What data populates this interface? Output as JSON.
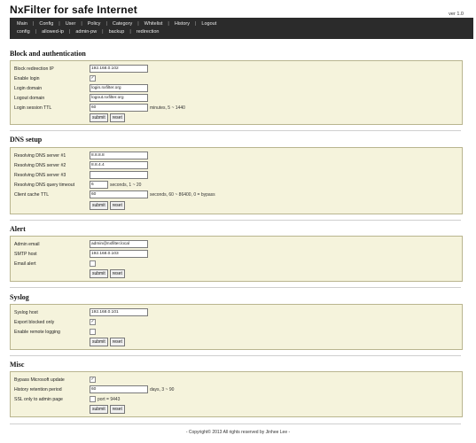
{
  "app": {
    "title": "NxFilter for safe Internet",
    "version": "ver 1.0"
  },
  "nav": {
    "row1": [
      "Main",
      "Config",
      "User",
      "Policy",
      "Category",
      "Whitelist",
      "History",
      "Logout"
    ],
    "row2": [
      "config",
      "allowed-ip",
      "admin-pw",
      "backup",
      "redirection"
    ]
  },
  "sections": {
    "block": {
      "title": "Block and authentication",
      "redirect_label": "Block redirection IP",
      "redirect_value": "192.168.0.102",
      "enable_login_label": "Enable login",
      "login_domain_label": "Login domain",
      "login_domain_value": "login.nxfilter.org",
      "logout_domain_label": "Logout domain",
      "logout_domain_value": "logout.nxfilter.org",
      "ttl_label": "Login session TTL",
      "ttl_value": "60",
      "ttl_unit": "minutes, 5 ~ 1440"
    },
    "dns": {
      "title": "DNS setup",
      "dns1_label": "Resolving DNS server #1",
      "dns1_value": "8.8.8.8",
      "dns2_label": "Resolving DNS server #2",
      "dns2_value": "8.8.4.4",
      "dns3_label": "Resolving DNS server #3",
      "dns3_value": "",
      "timeout_label": "Resolving DNS query timeout",
      "timeout_value": "6",
      "timeout_unit": "seconds, 1 ~ 20",
      "cache_label": "Client cache TTL",
      "cache_value": "60",
      "cache_unit": "seconds, 60 ~ 86400, 0 = bypass"
    },
    "alert": {
      "title": "Alert",
      "email_label": "Admin email",
      "email_value": "admin@nxfilter.local",
      "smtp_label": "SMTP host",
      "smtp_value": "192.168.0.103",
      "email_alert_label": "Email alert"
    },
    "syslog": {
      "title": "Syslog",
      "host_label": "Syslog host",
      "host_value": "192.168.0.101",
      "export_label": "Export blocked only",
      "remote_label": "Enable remote logging"
    },
    "misc": {
      "title": "Misc",
      "bypass_label": "Bypass Microsoft update",
      "retention_label": "History retention period",
      "retention_value": "60",
      "retention_unit": "days, 3 ~ 90",
      "ssl_label": "SSL only to admin page",
      "ssl_unit": "port = 9443"
    }
  },
  "buttons": {
    "submit": "submit",
    "reset": "reset"
  },
  "footer": "- Copyright© 2013 All rights reserved by Jinhee Lee -"
}
